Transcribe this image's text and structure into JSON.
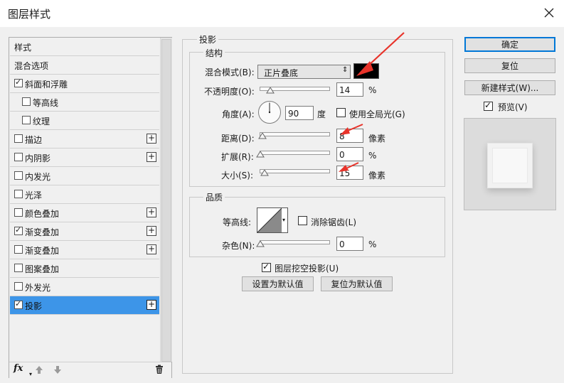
{
  "window": {
    "title": "图层样式"
  },
  "styles_list": {
    "items": [
      {
        "label": "样式",
        "checkbox": false,
        "checked": false,
        "plus": false,
        "indent": false,
        "selected": false
      },
      {
        "label": "混合选项",
        "checkbox": false,
        "checked": false,
        "plus": false,
        "indent": false,
        "selected": false
      },
      {
        "label": "斜面和浮雕",
        "checkbox": true,
        "checked": true,
        "plus": false,
        "indent": false,
        "selected": false
      },
      {
        "label": "等高线",
        "checkbox": true,
        "checked": false,
        "plus": false,
        "indent": true,
        "selected": false
      },
      {
        "label": "纹理",
        "checkbox": true,
        "checked": false,
        "plus": false,
        "indent": true,
        "selected": false
      },
      {
        "label": "描边",
        "checkbox": true,
        "checked": false,
        "plus": true,
        "indent": false,
        "selected": false
      },
      {
        "label": "内阴影",
        "checkbox": true,
        "checked": false,
        "plus": true,
        "indent": false,
        "selected": false
      },
      {
        "label": "内发光",
        "checkbox": true,
        "checked": false,
        "plus": false,
        "indent": false,
        "selected": false
      },
      {
        "label": "光泽",
        "checkbox": true,
        "checked": false,
        "plus": false,
        "indent": false,
        "selected": false
      },
      {
        "label": "颜色叠加",
        "checkbox": true,
        "checked": false,
        "plus": true,
        "indent": false,
        "selected": false
      },
      {
        "label": "渐变叠加",
        "checkbox": true,
        "checked": true,
        "plus": true,
        "indent": false,
        "selected": false
      },
      {
        "label": "渐变叠加",
        "checkbox": true,
        "checked": false,
        "plus": true,
        "indent": false,
        "selected": false
      },
      {
        "label": "图案叠加",
        "checkbox": true,
        "checked": false,
        "plus": false,
        "indent": false,
        "selected": false
      },
      {
        "label": "外发光",
        "checkbox": true,
        "checked": false,
        "plus": false,
        "indent": false,
        "selected": false
      },
      {
        "label": "投影",
        "checkbox": true,
        "checked": true,
        "plus": true,
        "indent": false,
        "selected": true
      }
    ],
    "footer_fx": "fx"
  },
  "drop_shadow": {
    "group_title": "投影",
    "structure": {
      "title": "结构",
      "blend_mode_label": "混合模式(B):",
      "blend_mode_value": "正片叠底",
      "shadow_color": "#000000",
      "opacity_label": "不透明度(O):",
      "opacity_value": "14",
      "opacity_unit": "%",
      "opacity_fraction": 0.14,
      "angle_label": "角度(A):",
      "angle_value": "90",
      "angle_unit": "度",
      "global_light_label": "使用全局光(G)",
      "global_light_checked": false,
      "distance_label": "距离(D):",
      "distance_value": "8",
      "distance_unit": "像素",
      "distance_fraction": 0.03,
      "spread_label": "扩展(R):",
      "spread_value": "0",
      "spread_unit": "%",
      "spread_fraction": 0,
      "size_label": "大小(S):",
      "size_value": "15",
      "size_unit": "像素",
      "size_fraction": 0.06
    },
    "quality": {
      "title": "品质",
      "contour_label": "等高线:",
      "antialias_label": "消除锯齿(L)",
      "antialias_checked": false,
      "noise_label": "杂色(N):",
      "noise_value": "0",
      "noise_unit": "%",
      "noise_fraction": 0
    },
    "knockout_label": "图层挖空投影(U)",
    "knockout_checked": true,
    "make_default_label": "设置为默认值",
    "reset_default_label": "复位为默认值"
  },
  "buttons": {
    "ok": "确定",
    "reset": "复位",
    "new_style": "新建样式(W)...",
    "preview_label": "预览(V)",
    "preview_checked": true
  },
  "colors": {
    "selection": "#3d95e8",
    "annotation_arrow": "#e8332a"
  }
}
